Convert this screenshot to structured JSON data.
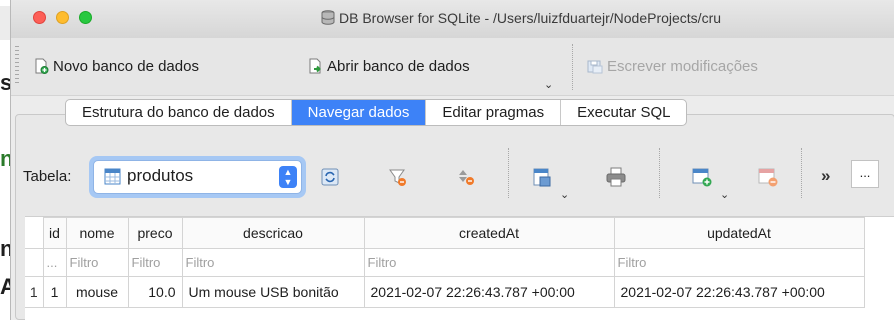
{
  "window": {
    "title": "DB Browser for SQLite - /Users/luizfduartejr/NodeProjects/cru"
  },
  "toolbar": {
    "new_db": "Novo banco de dados",
    "open_db": "Abrir banco de dados",
    "write_changes": "Escrever modificações"
  },
  "tabs": [
    {
      "label": "Estrutura do banco de dados",
      "active": false
    },
    {
      "label": "Navegar dados",
      "active": true
    },
    {
      "label": "Editar pragmas",
      "active": false
    },
    {
      "label": "Executar SQL",
      "active": false
    }
  ],
  "browse": {
    "table_label": "Tabela:",
    "table_value": "produtos",
    "more_label": "»",
    "ellipsis": "..."
  },
  "grid": {
    "columns": [
      "id",
      "nome",
      "preco",
      "descricao",
      "createdAt",
      "updatedAt"
    ],
    "filter_corner": "...",
    "filter_placeholder": "Filtro",
    "rows": [
      {
        "rownum": "1",
        "cells": [
          "1",
          "mouse",
          "10.0",
          "Um mouse USB bonitão",
          "2021-02-07 22:26:43.787 +00:00",
          "2021-02-07 22:26:43.787 +00:00"
        ]
      }
    ]
  },
  "colors": {
    "accent": "#3d82f7",
    "combo_focus": "#a6c8f4"
  },
  "icons": {
    "new_db": "new-database-icon",
    "open_db": "open-database-icon",
    "write": "write-changes-icon",
    "refresh": "refresh-icon",
    "clear_filter": "clear-filter-icon",
    "sort": "sort-icon",
    "save_table": "save-table-icon",
    "print": "print-icon",
    "insert_record": "insert-record-icon",
    "delete_record": "delete-record-icon"
  }
}
